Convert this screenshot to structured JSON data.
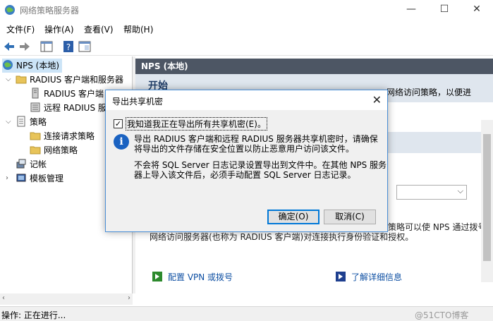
{
  "window": {
    "title": "网络策略服务器",
    "minimize_glyph": "—",
    "maximize_glyph": "☐",
    "close_glyph": "✕"
  },
  "menu": [
    "文件(F)",
    "操作(A)",
    "查看(V)",
    "帮助(H)"
  ],
  "toolbar": {
    "icons": [
      "back-icon",
      "forward-icon",
      "show-hide-tree-icon",
      "help-icon",
      "properties-icon"
    ]
  },
  "tree": {
    "root": "NPS (本地)",
    "radius_clients_servers": "RADIUS 客户端和服务器",
    "radius_clients": "RADIUS 客户端",
    "remote_radius": "远程 RADIUS 服",
    "policies": "策略",
    "connection_request": "连接请求策略",
    "network_policies": "网络策略",
    "accounting": "记帐",
    "template_mgmt": "模板管理"
  },
  "content": {
    "header": "NPS (本地)",
    "band_title": "开始",
    "band_text_right": "网络访问策略，以便进",
    "body_right": "策略可以使 NPS 通过拨号",
    "body_line2": "网络访问服务器(也称为 RADIUS 客户端)对连接执行身份验证和授权。",
    "link_vpn": "配置 VPN 或拨号",
    "link_learn": "了解详细信息"
  },
  "dialog": {
    "title": "导出共享机密",
    "checkbox_label": "我知道我正在导出所有共享机密(E)。",
    "checked": true,
    "msg1_line1": "导出 RADIUS 客户端和远程 RADIUS 服务器共享机密时，请确保",
    "msg1_line2": "将导出的文件存储在安全位置以防止恶意用户访问该文件。",
    "msg2_line1": "不会将 SQL Server 日志记录设置导出到文件中。在其他 NPS 服务",
    "msg2_line2": "器上导入该文件后，必须手动配置 SQL Server 日志记录。",
    "ok": "确定(O)",
    "cancel": "取消(C)"
  },
  "status": {
    "text": "操作: 正在进行...",
    "watermark": "@51CTO博客"
  }
}
